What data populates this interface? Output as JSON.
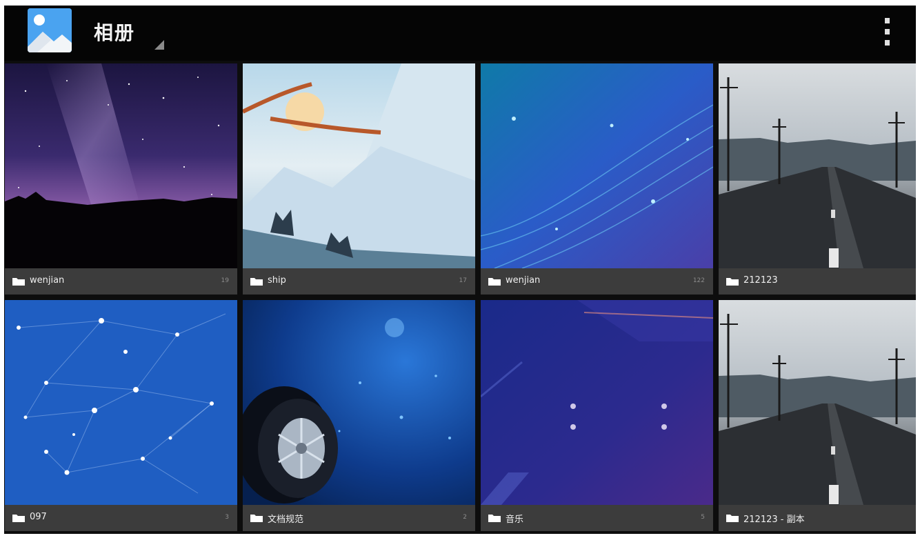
{
  "app": {
    "title": "相册",
    "icon": "gallery-icon",
    "menu_icon": "overflow-menu-icon"
  },
  "albums": [
    {
      "name": "wenjian",
      "count": "19"
    },
    {
      "name": "ship",
      "count": "17"
    },
    {
      "name": "wenjian",
      "count": "122"
    },
    {
      "name": "212123",
      "count": ""
    },
    {
      "name": "097",
      "count": "3"
    },
    {
      "name": "文档规范",
      "count": "2"
    },
    {
      "name": "音乐",
      "count": "5"
    },
    {
      "name": "212123 - 副本",
      "count": ""
    }
  ],
  "colors": {
    "action_bar": "#050505",
    "label_bar": "#3e3e3e",
    "icon_blue": "#4aa3f0"
  }
}
